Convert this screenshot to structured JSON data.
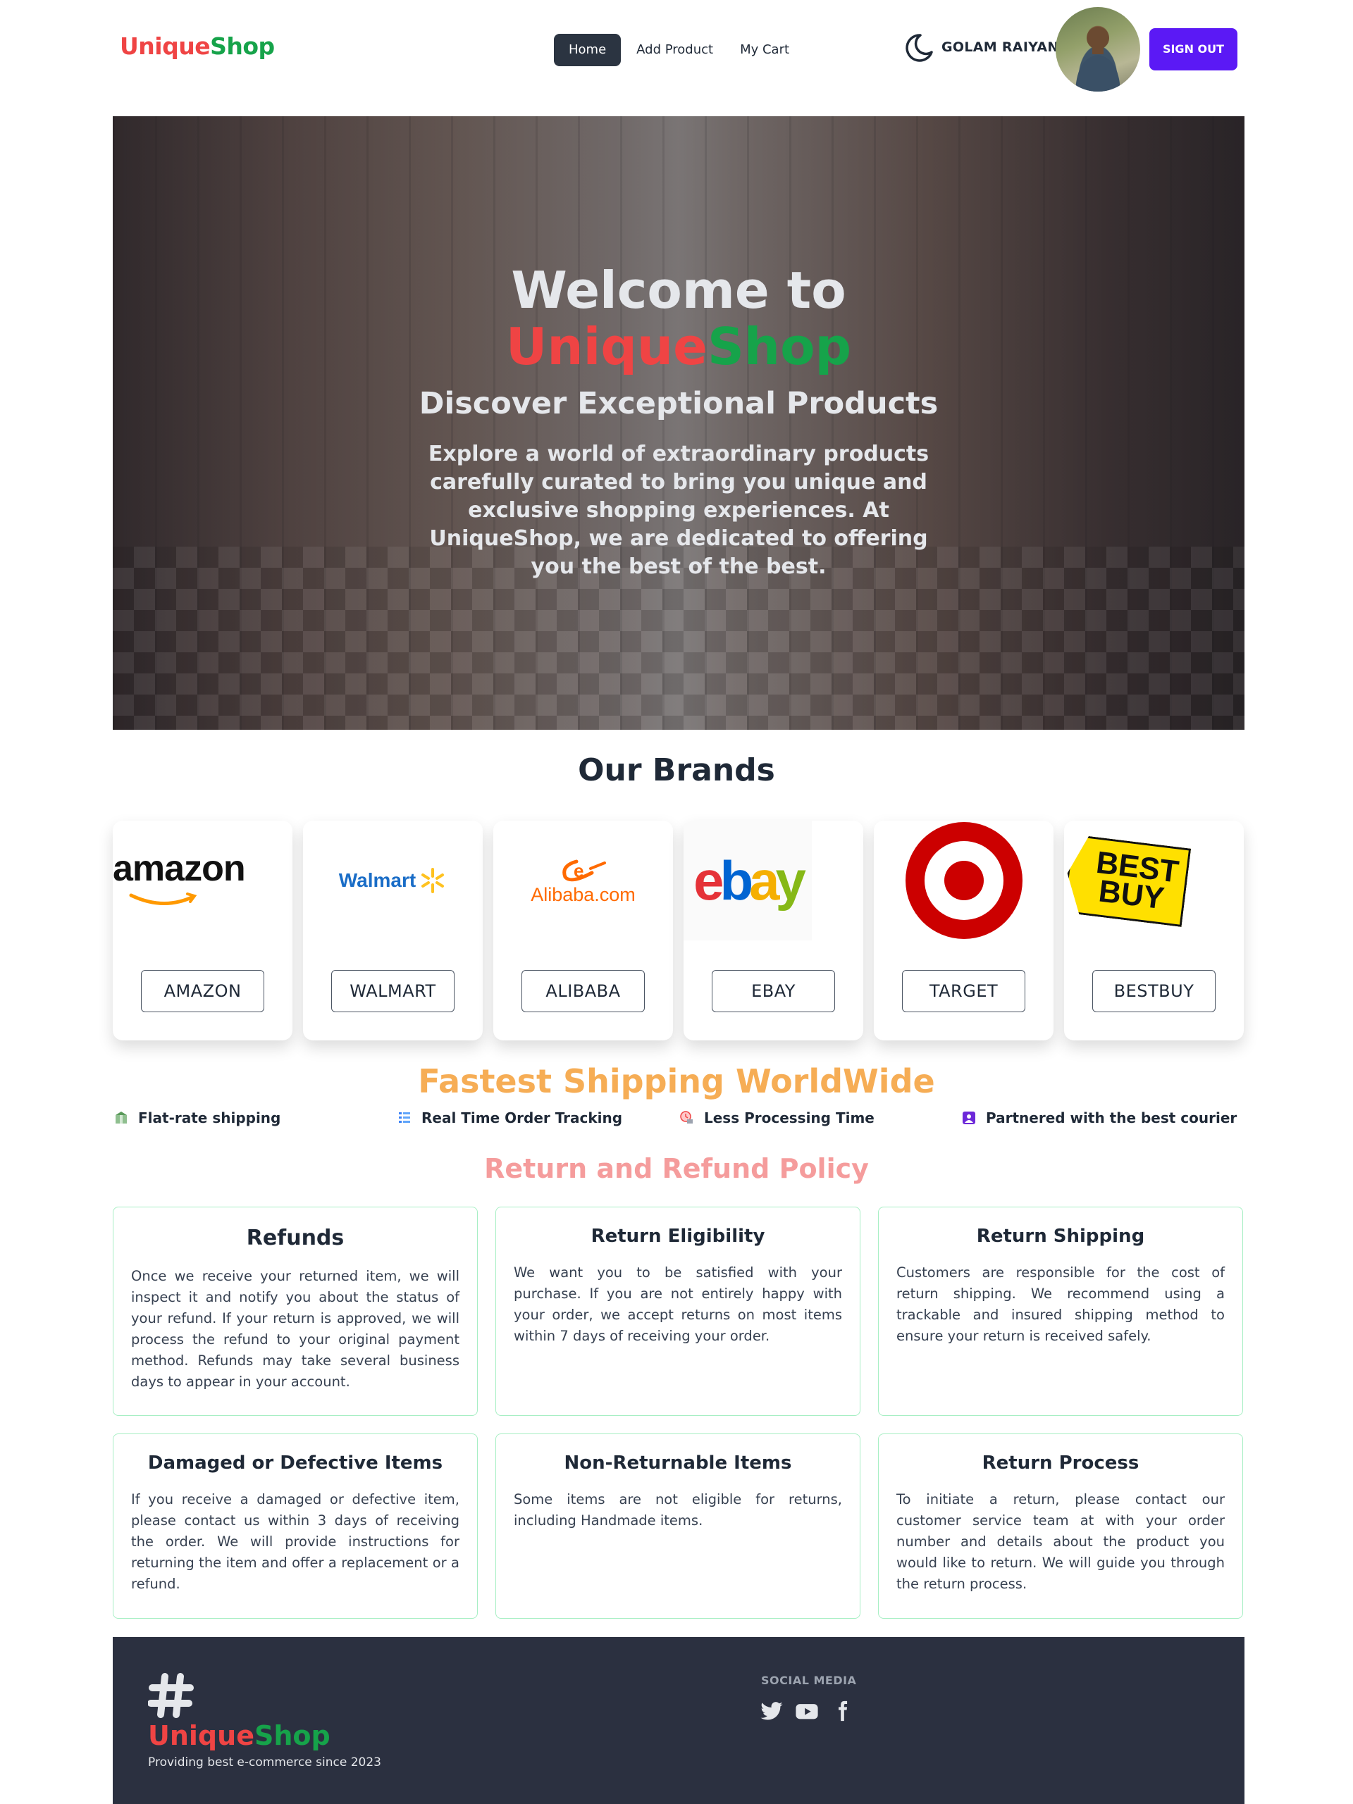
{
  "navbar": {
    "logo": {
      "part1": "Unique",
      "part2": "Shop"
    },
    "links": [
      {
        "label": "Home",
        "active": true
      },
      {
        "label": "Add Product",
        "active": false
      },
      {
        "label": "My Cart",
        "active": false
      }
    ],
    "theme_toggle_icon": "moon-icon",
    "username": "GOLAM RAIYAN",
    "signout_label": "SIGN OUT"
  },
  "hero": {
    "title_line1": "Welcome to",
    "title_brand": {
      "part1": "Unique",
      "part2": "Shop"
    },
    "subtitle": "Discover Exceptional Products",
    "description": "Explore a world of extraordinary products carefully curated to bring you unique and exclusive shopping experiences. At UniqueShop, we are dedicated to offering you the best of the best."
  },
  "brands": {
    "title": "Our Brands",
    "items": [
      {
        "logo_text": "amazon",
        "button": "AMAZON"
      },
      {
        "logo_text": "Walmart",
        "button": "WALMART"
      },
      {
        "logo_text": "Alibaba.com",
        "button": "ALIBABA"
      },
      {
        "logo_text": "ebay",
        "button": "EBAY"
      },
      {
        "logo_text": "",
        "button": "TARGET"
      },
      {
        "logo_text": "BEST BUY",
        "button": "BESTBUY"
      }
    ]
  },
  "shipping": {
    "title": "Fastest Shipping WorldWide",
    "features": [
      {
        "label": "Flat-rate shipping",
        "icon": "package-icon"
      },
      {
        "label": "Real Time Order Tracking",
        "icon": "list-icon"
      },
      {
        "label": "Less Processing Time",
        "icon": "clock-icon"
      },
      {
        "label": "Partnered with the best courier",
        "icon": "courier-icon"
      }
    ]
  },
  "policy": {
    "title": "Return and Refund Policy",
    "cards": [
      {
        "title": "Refunds",
        "text": "Once we receive your returned item, we will inspect it and notify you about the status of your refund. If your return is approved, we will process the refund to your original payment method. Refunds may take several business days to appear in your account."
      },
      {
        "title": "Return Eligibility",
        "text": "We want you to be satisfied with your purchase. If you are not entirely happy with your order, we accept returns on most items within 7 days of receiving your order."
      },
      {
        "title": "Return Shipping",
        "text": "Customers are responsible for the cost of return shipping. We recommend using a trackable and insured shipping method to ensure your return is received safely."
      },
      {
        "title": "Damaged or Defective Items",
        "text": "If you receive a damaged or defective item, please contact us within 3 days of receiving the order. We will provide instructions for returning the item and offer a replacement or a refund."
      },
      {
        "title": "Non-Returnable Items",
        "text": "Some items are not eligible for returns, including Handmade items."
      },
      {
        "title": "Return Process",
        "text": "To initiate a return, please contact our customer service team at with your order number and details about the product you would like to return. We will guide you through the return process."
      }
    ]
  },
  "footer": {
    "logo": {
      "part1": "Unique",
      "part2": "Shop"
    },
    "tagline": "Providing best e-commerce since 2023",
    "social_title": "SOCIAL MEDIA",
    "social_icons": [
      "twitter-icon",
      "youtube-icon",
      "facebook-icon"
    ]
  },
  "colors": {
    "brand_red": "#ef4444",
    "brand_green": "#16a34a",
    "signout": "#5b19f5",
    "shipping_title": "#f6ad55",
    "policy_title": "#f59c9c",
    "footer_bg": "#2b3040"
  }
}
